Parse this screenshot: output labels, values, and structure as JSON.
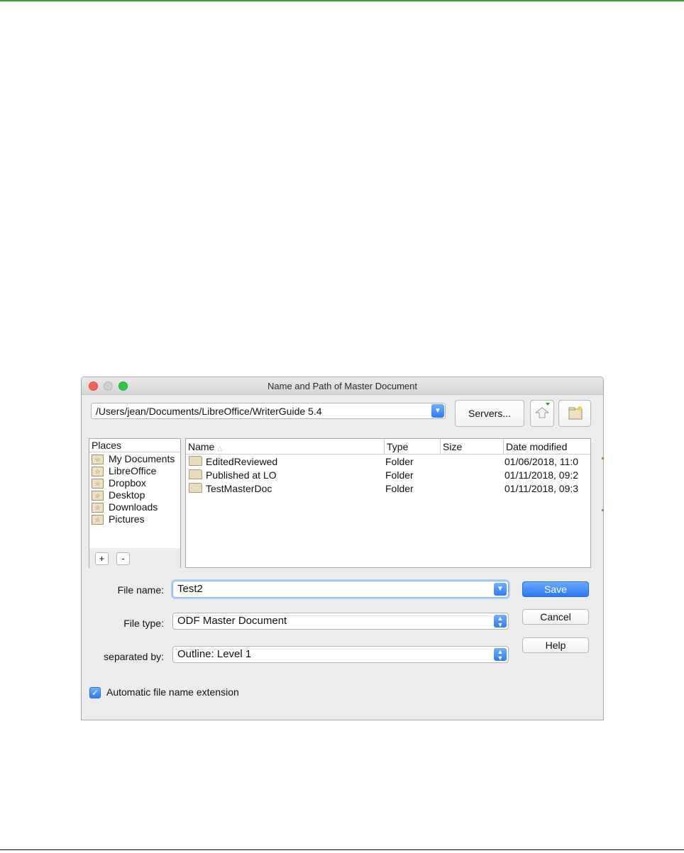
{
  "dialog": {
    "title": "Name and Path of Master Document",
    "path": "/Users/jean/Documents/LibreOffice/WriterGuide 5.4",
    "servers_label": "Servers...",
    "places": {
      "header": "Places",
      "items": [
        {
          "label": "My Documents",
          "icon": "star-folder-icon"
        },
        {
          "label": "LibreOffice",
          "icon": "star-folder-icon"
        },
        {
          "label": "Dropbox",
          "icon": "star-folder-icon"
        },
        {
          "label": "Desktop",
          "icon": "star-folder-icon"
        },
        {
          "label": "Downloads",
          "icon": "star-folder-icon"
        },
        {
          "label": "Pictures",
          "icon": "star-folder-icon"
        }
      ],
      "add_label": "+",
      "remove_label": "-"
    },
    "files": {
      "columns": [
        "Name",
        "Type",
        "Size",
        "Date modified"
      ],
      "rows": [
        {
          "name": "EditedReviewed",
          "type": "Folder",
          "size": "",
          "date": "01/06/2018, 11:0"
        },
        {
          "name": "Published at LO",
          "type": "Folder",
          "size": "",
          "date": "01/11/2018, 09:2"
        },
        {
          "name": "TestMasterDoc",
          "type": "Folder",
          "size": "",
          "date": "01/11/2018, 09:3"
        }
      ]
    },
    "form": {
      "file_name_label": "File name:",
      "file_name_value": "Test2",
      "file_type_label": "File type:",
      "file_type_value": "ODF Master Document",
      "separated_label": "separated by:",
      "separated_value": "Outline: Level 1"
    },
    "buttons": {
      "save": "Save",
      "cancel": "Cancel",
      "help": "Help"
    },
    "auto_extension": {
      "label": "Automatic file name extension",
      "checked": true
    },
    "colors": {
      "accent": "#2f7bf5",
      "close": "#fc5f57",
      "maximize": "#2ac940"
    }
  }
}
